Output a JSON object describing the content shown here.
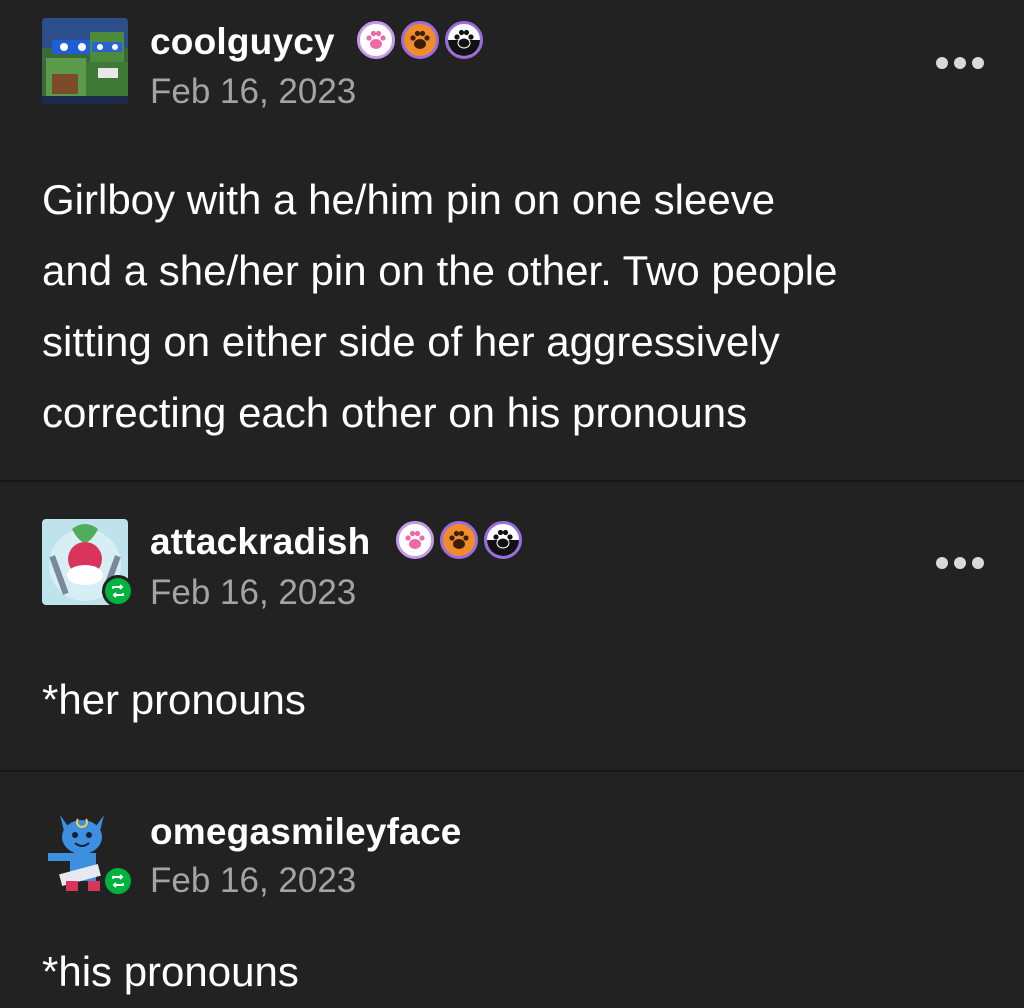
{
  "posts": [
    {
      "username": "coolguycy",
      "date": "Feb 16, 2023",
      "body_lines": [
        "Girlboy with a he/him pin on one sleeve",
        "and a she/her pin on the other. Two people",
        "sitting on either side of her aggressively",
        "correcting each other on his pronouns"
      ],
      "badges": [
        "paw-badge-pink-icon",
        "paw-badge-orange-icon",
        "paw-badge-black-icon"
      ],
      "has_more_menu": true,
      "reblogged": false
    },
    {
      "username": "attackradish",
      "date": "Feb 16, 2023",
      "body_lines": [
        "*her pronouns"
      ],
      "badges": [
        "paw-badge-pink-icon",
        "paw-badge-orange-icon",
        "paw-badge-black-icon"
      ],
      "has_more_menu": true,
      "reblogged": true
    },
    {
      "username": "omegasmileyface",
      "date": "Feb 16, 2023",
      "body_lines": [
        "*his pronouns"
      ],
      "badges": [],
      "has_more_menu": false,
      "reblogged": true
    }
  ],
  "colors": {
    "background": "#222222",
    "divider": "#161616",
    "text": "#ffffff",
    "timestamp": "#a4a4a4",
    "reblog_badge": "#00b33c"
  }
}
